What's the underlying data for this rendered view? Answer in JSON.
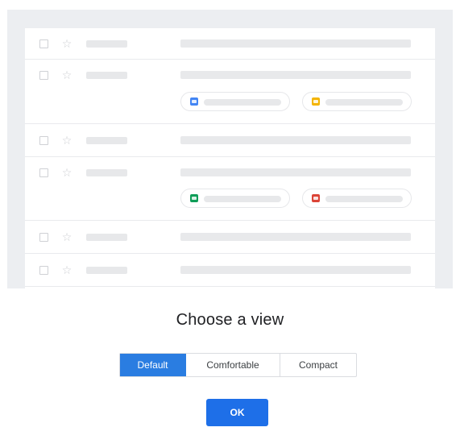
{
  "dialog": {
    "title": "Choose a view",
    "options": [
      "Default",
      "Comfortable",
      "Compact"
    ],
    "selected_option": "Default",
    "ok_label": "OK"
  },
  "preview": {
    "rows": 6,
    "rows_with_attachments": [
      2,
      4
    ],
    "star_glyph": "☆",
    "attachment_icons": [
      {
        "name": "docs-icon",
        "color": "#4285f4"
      },
      {
        "name": "slides-icon",
        "color": "#f4b400"
      },
      {
        "name": "sheets-icon",
        "color": "#0f9d58"
      },
      {
        "name": "photos-icon",
        "color": "#db4437"
      }
    ]
  },
  "colors": {
    "accent": "#1e6fe8",
    "selected_segment": "#2a7de1"
  }
}
